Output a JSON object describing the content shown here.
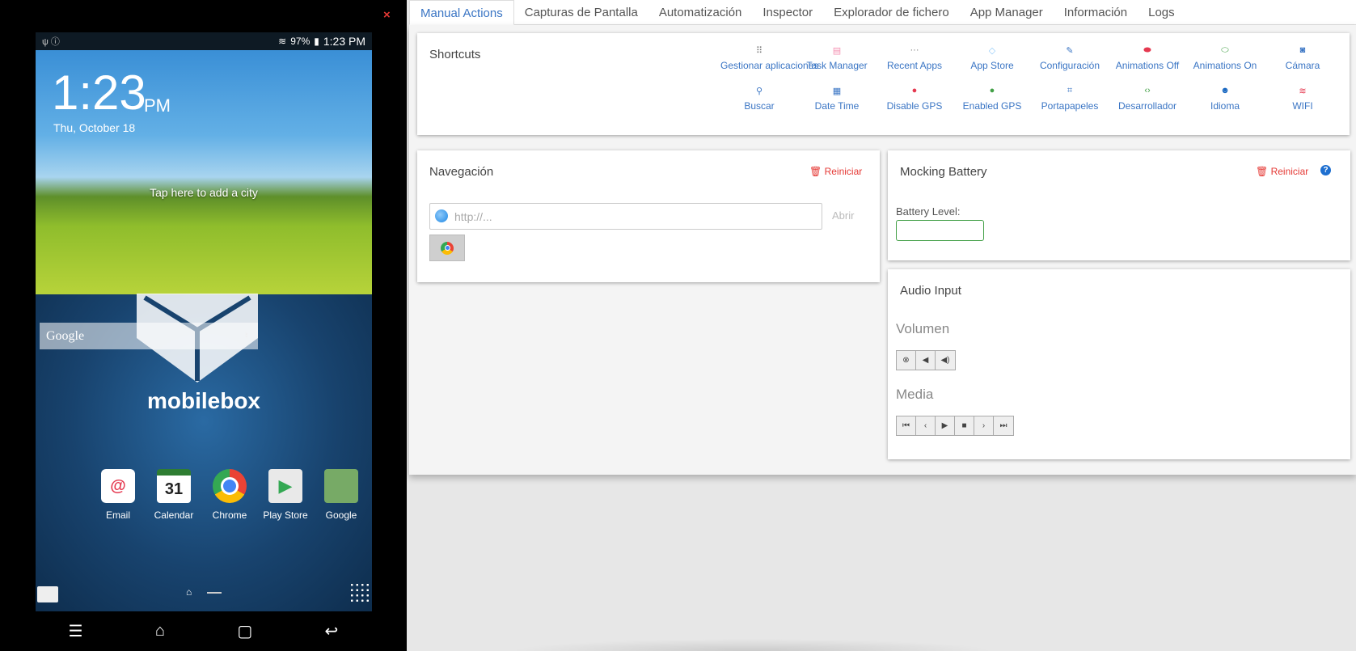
{
  "device": {
    "close_glyph": "×",
    "status": {
      "left_icons": "ψ ⓘ",
      "battery": "97%",
      "time": "1:23 PM"
    },
    "lock": {
      "time": "1:23",
      "ampm": "PM",
      "date": "Thu, October 18",
      "weather_prompt": "Tap here to add a city"
    },
    "google_widget": "Google",
    "brand": "mobilebox",
    "dock": [
      {
        "label": "Email",
        "icon": "email-icon"
      },
      {
        "label": "Calendar",
        "icon": "calendar-icon",
        "badge": "31"
      },
      {
        "label": "Chrome",
        "icon": "chrome-icon"
      },
      {
        "label": "Play Store",
        "icon": "play-store-icon"
      },
      {
        "label": "Google",
        "icon": "google-folder-icon"
      }
    ],
    "nav": {
      "menu": "☰",
      "home": "⌂",
      "recents": "▢",
      "back": "↩"
    }
  },
  "tabs": [
    "Manual Actions",
    "Capturas de Pantalla",
    "Automatización",
    "Inspector",
    "Explorador de fichero",
    "App Manager",
    "Información",
    "Logs"
  ],
  "active_tab": "Manual Actions",
  "shortcuts": {
    "title": "Shortcuts",
    "items": [
      {
        "label": "Gestionar aplicaciones",
        "icon": "grid-icon"
      },
      {
        "label": "Task Manager",
        "icon": "list-icon"
      },
      {
        "label": "Recent Apps",
        "icon": "ellipsis-icon"
      },
      {
        "label": "App Store",
        "icon": "tag-icon"
      },
      {
        "label": "Configuración",
        "icon": "wrench-icon"
      },
      {
        "label": "Animations Off",
        "icon": "toggle-off-icon"
      },
      {
        "label": "Animations On",
        "icon": "toggle-on-icon"
      },
      {
        "label": "Cámara",
        "icon": "camera-icon"
      },
      {
        "label": "Buscar",
        "icon": "search-icon"
      },
      {
        "label": "Date Time",
        "icon": "calendar-icon"
      },
      {
        "label": "Disable GPS",
        "icon": "compass-icon"
      },
      {
        "label": "Enabled GPS",
        "icon": "compass-icon"
      },
      {
        "label": "Portapapeles",
        "icon": "crop-icon"
      },
      {
        "label": "Desarrollador",
        "icon": "code-icon"
      },
      {
        "label": "Idioma",
        "icon": "users-icon"
      },
      {
        "label": "WIFI",
        "icon": "wifi-icon"
      }
    ]
  },
  "navegacion": {
    "title": "Navegación",
    "reset": "Reiniciar",
    "url_placeholder": "http://...",
    "open": "Abrir"
  },
  "battery": {
    "title": "Mocking Battery",
    "reset": "Reiniciar",
    "level_label": "Battery Level:",
    "level_value": ""
  },
  "audio": {
    "title": "Audio Input",
    "volume_label": "Volumen",
    "media_label": "Media"
  },
  "colors": {
    "accent": "#3a75c4",
    "danger": "#e53935",
    "success": "#43a047"
  }
}
